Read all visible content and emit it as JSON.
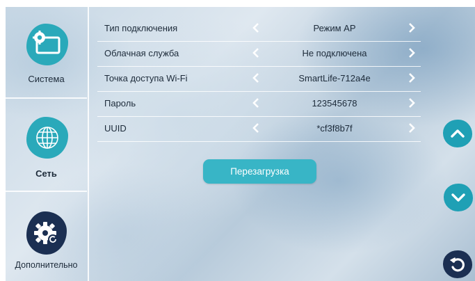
{
  "sidebar": {
    "items": [
      {
        "label": "Система",
        "icon": "system-settings-icon",
        "active": false
      },
      {
        "label": "Сеть",
        "icon": "network-globe-icon",
        "active": true
      },
      {
        "label": "Дополнительно",
        "icon": "advanced-gear-icon",
        "active": false
      }
    ]
  },
  "settings": {
    "rows": [
      {
        "label": "Тип подключения",
        "value": "Режим AP"
      },
      {
        "label": "Облачная служба",
        "value": "Не подключена"
      },
      {
        "label": "Точка доступа Wi-Fi",
        "value": "SmartLife-712a4e"
      },
      {
        "label": "Пароль",
        "value": "123545678"
      },
      {
        "label": "UUID",
        "value": "*cf3f8b7f"
      }
    ]
  },
  "actions": {
    "reboot_label": "Перезагрузка"
  },
  "controls": {
    "up_icon": "chevron-up-icon",
    "down_icon": "chevron-down-icon",
    "back_icon": "back-arrow-icon"
  },
  "colors": {
    "accent": "#2aa9ba",
    "dark": "#1b2f52",
    "button": "#38b5c6"
  }
}
